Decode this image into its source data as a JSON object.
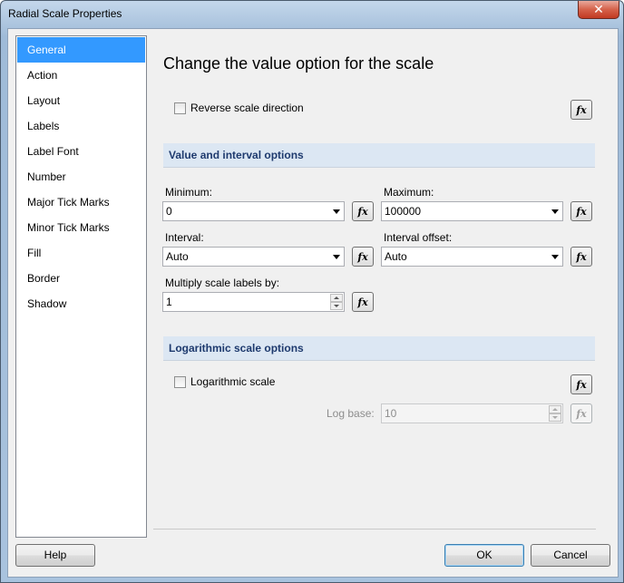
{
  "window": {
    "title": "Radial Scale Properties",
    "close_glyph": "✕"
  },
  "nav": {
    "items": [
      {
        "label": "General",
        "active": true
      },
      {
        "label": "Action"
      },
      {
        "label": "Layout"
      },
      {
        "label": "Labels"
      },
      {
        "label": "Label Font"
      },
      {
        "label": "Number"
      },
      {
        "label": "Major Tick Marks"
      },
      {
        "label": "Minor Tick Marks"
      },
      {
        "label": "Fill"
      },
      {
        "label": "Border"
      },
      {
        "label": "Shadow"
      }
    ]
  },
  "main": {
    "heading": "Change the value option for the scale",
    "reverse_label": "Reverse scale direction",
    "reverse_checked": false,
    "fx_label": "fx",
    "value_section": "Value and interval options",
    "minimum_label": "Minimum:",
    "minimum_value": "0",
    "maximum_label": "Maximum:",
    "maximum_value": "100000",
    "interval_label": "Interval:",
    "interval_value": "Auto",
    "interval_offset_label": "Interval offset:",
    "interval_offset_value": "Auto",
    "multiply_label": "Multiply scale labels by:",
    "multiply_value": "1",
    "log_section": "Logarithmic scale options",
    "log_label": "Logarithmic scale",
    "log_checked": false,
    "log_base_label": "Log base:",
    "log_base_value": "10"
  },
  "footer": {
    "help": "Help",
    "ok": "OK",
    "cancel": "Cancel"
  },
  "colors": {
    "selected": "#3399ff",
    "section_bg": "#dce7f3",
    "section_text": "#1e3a6e"
  }
}
